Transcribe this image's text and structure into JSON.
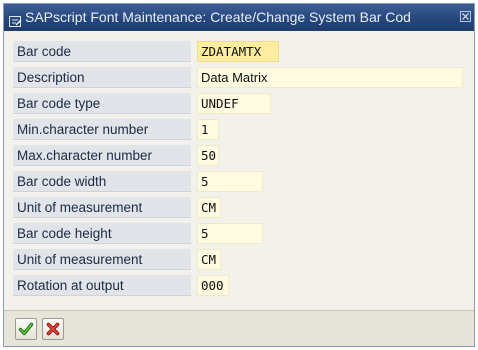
{
  "window": {
    "title": "SAPscript Font Maintenance: Create/Change System Bar Cod"
  },
  "fields": [
    {
      "label": "Bar code",
      "value": "ZDATAMTX"
    },
    {
      "label": "Description",
      "value": "Data Matrix"
    },
    {
      "label": "Bar code type",
      "value": "UNDEF"
    },
    {
      "label": "Min.character number",
      "value": "1"
    },
    {
      "label": "Max.character number",
      "value": "50"
    },
    {
      "label": "Bar code width",
      "value": "5"
    },
    {
      "label": "Unit of measurement",
      "value": "CM"
    },
    {
      "label": "Bar code height",
      "value": "5"
    },
    {
      "label": "Unit of measurement",
      "value": "CM"
    },
    {
      "label": "Rotation at output",
      "value": "000"
    }
  ],
  "toolbar": {
    "confirm_icon": "checkmark-icon",
    "cancel_icon": "cancel-x-icon"
  },
  "colors": {
    "title_bar": "#26477d",
    "label_bg": "#e1e4e8",
    "input_bg": "#fffbe0",
    "highlight_bg": "#ffeea0",
    "confirm_green": "#2e8b1f",
    "cancel_red": "#c8231c"
  }
}
